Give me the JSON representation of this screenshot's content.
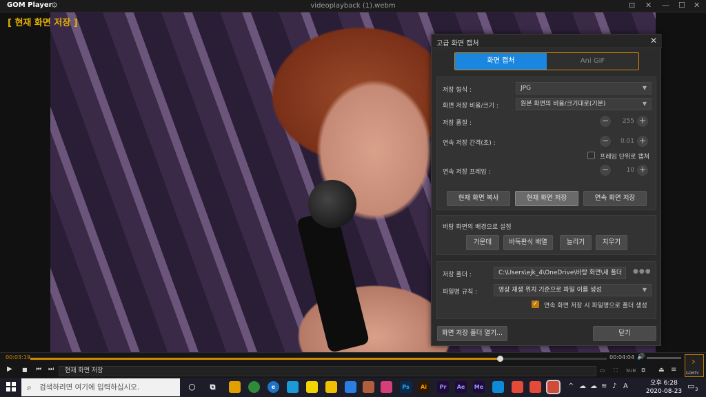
{
  "window": {
    "app_name": "GOM Player",
    "title": "videoplayback (1).webm",
    "osd_text": "[ 현재 화면 저장 ]"
  },
  "dialog": {
    "title": "고급 화면 캡처",
    "tabs": [
      {
        "label": "화면 캡처",
        "active": true
      },
      {
        "label": "Ani GIF",
        "active": false
      }
    ],
    "format_label": "저장 형식 :",
    "format_value": "JPG",
    "ratio_label": "화면 저장 비율/크기 :",
    "ratio_value": "원본 화면의 비율/크기대로(기본)",
    "quality_label": "저장 품질 :",
    "quality_value": "255",
    "interval_label": "연속 저장 간격(초) :",
    "interval_value": "0.01",
    "frame_unit_label": "프레임 단위로 캡쳐",
    "frames_label": "연속 저장 프레임 :",
    "frames_value": "10",
    "btn_copy": "현재 화면 복사",
    "btn_save": "현재 화면 저장",
    "btn_continuous": "연속 화면 저장",
    "wallpaper_label": "바탕 화면의 배경으로 설정",
    "btn_center": "가운데",
    "btn_tile": "바둑판식 배열",
    "btn_stretch": "늘리기",
    "btn_clear": "지우기",
    "folder_label": "저장 폴더 :",
    "folder_value": "C:\\Users\\ejk_4\\OneDrive\\바탕 화면\\새 폴더",
    "filename_label": "파일명 규칙 :",
    "filename_value": "영상 재생 위치 기준으로 파일 이름 생성",
    "subfolder_label": "연속 화면 저장 시 파일명으로 폴더 생성",
    "btn_open_folder": "화면 저장 폴더 열기...",
    "btn_close": "닫기"
  },
  "player": {
    "elapsed": "00:03:19",
    "total": "00:04:04",
    "progress": 0.815,
    "now_playing": "현재 화면 저장",
    "brand_label": "GOMTV"
  },
  "taskbar": {
    "search_placeholder": "검색하려면 여기에 입력하십시오.",
    "time": "오후 6:28",
    "date": "2020-08-23",
    "notification_count": "3",
    "colors": {
      "accent": "#d48a00",
      "tab_active": "#1a86e0"
    }
  }
}
